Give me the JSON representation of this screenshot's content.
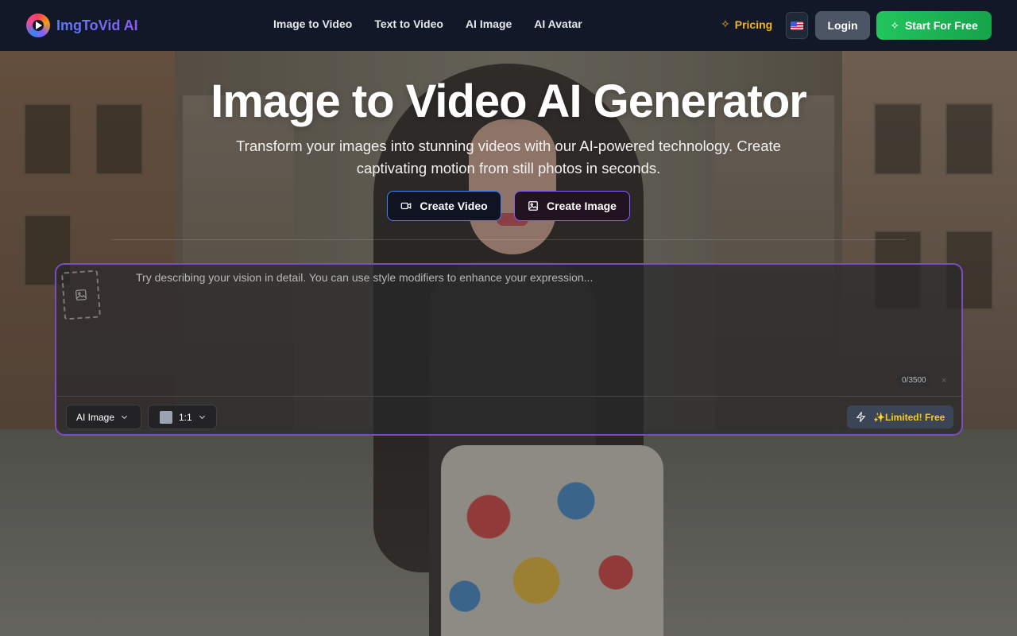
{
  "brand": {
    "name": "ImgToVid AI"
  },
  "nav": {
    "items": [
      {
        "label": "Image to Video"
      },
      {
        "label": "Text to Video"
      },
      {
        "label": "AI Image"
      },
      {
        "label": "AI Avatar"
      }
    ],
    "pricing": "Pricing",
    "language_flag": "us-flag-icon",
    "login": "Login",
    "start": "Start For Free"
  },
  "hero": {
    "title": "Image to Video AI Generator",
    "subtitle": "Transform your images into stunning videos with our AI-powered technology. Create captivating motion from still photos in seconds.",
    "create_video": "Create Video",
    "create_image": "Create Image"
  },
  "prompt": {
    "placeholder": "Try describing your vision in detail. You can use style modifiers to enhance your expression...",
    "value": "",
    "counter": "0/3500",
    "clear": "×",
    "model": "AI Image",
    "ratio": "1:1",
    "generate": "✨Limited! Free"
  },
  "colors": {
    "nav_bg": "#111827",
    "start_green": "#22c55e",
    "pricing_gold": "#f5b52a",
    "panel_border": "#7c4dbf",
    "limited_yellow": "#facc15"
  }
}
